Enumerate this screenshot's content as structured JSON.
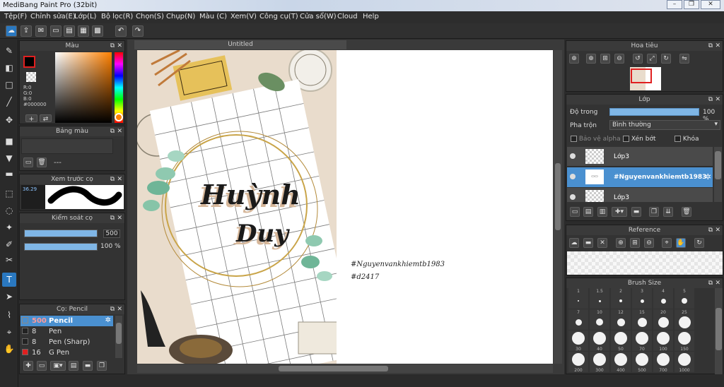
{
  "window": {
    "title": "MediBang Paint Pro (32bit)"
  },
  "menu": [
    "Tệp(F)",
    "Chỉnh sửa(E)",
    "Lớp(L)",
    "Bộ lọc(R)",
    "Chọn(S)",
    "Chụp(N)",
    "Màu (C)",
    "Xem(V)",
    "Công cụ(T)",
    "Cửa sổ(W)",
    "Cloud",
    "Help"
  ],
  "color_panel": {
    "title": "Màu",
    "r": "R:0",
    "g": "G:0",
    "b": "B:0",
    "hex": "#000000"
  },
  "palette_panel": {
    "title": "Bảng màu",
    "dash": "---"
  },
  "brush_preview": {
    "title": "Xem trước cọ",
    "size": "36.29"
  },
  "brush_control": {
    "title": "Kiểm soát cọ",
    "size_value": "500",
    "opacity_value": "100 %",
    "size_fill": 1.0,
    "opacity_fill": 1.0
  },
  "brush_list": {
    "title": "Cọ: Pencil",
    "items": [
      {
        "size": "500",
        "name": "Pencil",
        "active": true,
        "swatch": "#2d2d2d"
      },
      {
        "size": "8",
        "name": "Pen",
        "active": false,
        "swatch": "#222222"
      },
      {
        "size": "8",
        "name": "Pen (Sharp)",
        "active": false,
        "swatch": "#222222"
      },
      {
        "size": "16",
        "name": "G Pen",
        "active": false,
        "swatch": "#e02020"
      }
    ]
  },
  "document": {
    "tab": "Untitled",
    "caption_line1": "#Nguyenvankhiemtb1983",
    "caption_line2": "#d2417",
    "art_title_1": "Huỳnh",
    "art_title_2": "Duy"
  },
  "navigator": {
    "title": "Hoa tiêu"
  },
  "layers": {
    "title": "Lớp",
    "opacity_label": "Độ trong",
    "opacity_value": "100 %",
    "blend_label": "Pha trộn",
    "blend_value": "Bình thường",
    "protect_alpha": "Bảo vệ alpha",
    "clip": "Xén bớt",
    "lock": "Khóa",
    "items": [
      {
        "name": "Lớp3",
        "selected": false
      },
      {
        "name": "#Nguyenvankhiemtb1983",
        "selected": true
      },
      {
        "name": "Lớp3",
        "selected": false
      }
    ]
  },
  "reference": {
    "title": "Reference"
  },
  "brush_size": {
    "title": "Brush Size",
    "row1": [
      "1",
      "1.5",
      "2",
      "3",
      "4",
      "5"
    ],
    "row2": [
      "7",
      "10",
      "12",
      "15",
      "20",
      "25"
    ],
    "row3": [
      "30",
      "40",
      "50",
      "70",
      "100",
      "150"
    ],
    "row4": [
      "200",
      "300",
      "400",
      "500",
      "700",
      "1000"
    ]
  },
  "colors": {
    "accent": "#2a78c0",
    "selected_layer": "#4a90d0",
    "slider": "#7fb6e6",
    "primary_color": "#000000",
    "red_border": "#e02020"
  }
}
